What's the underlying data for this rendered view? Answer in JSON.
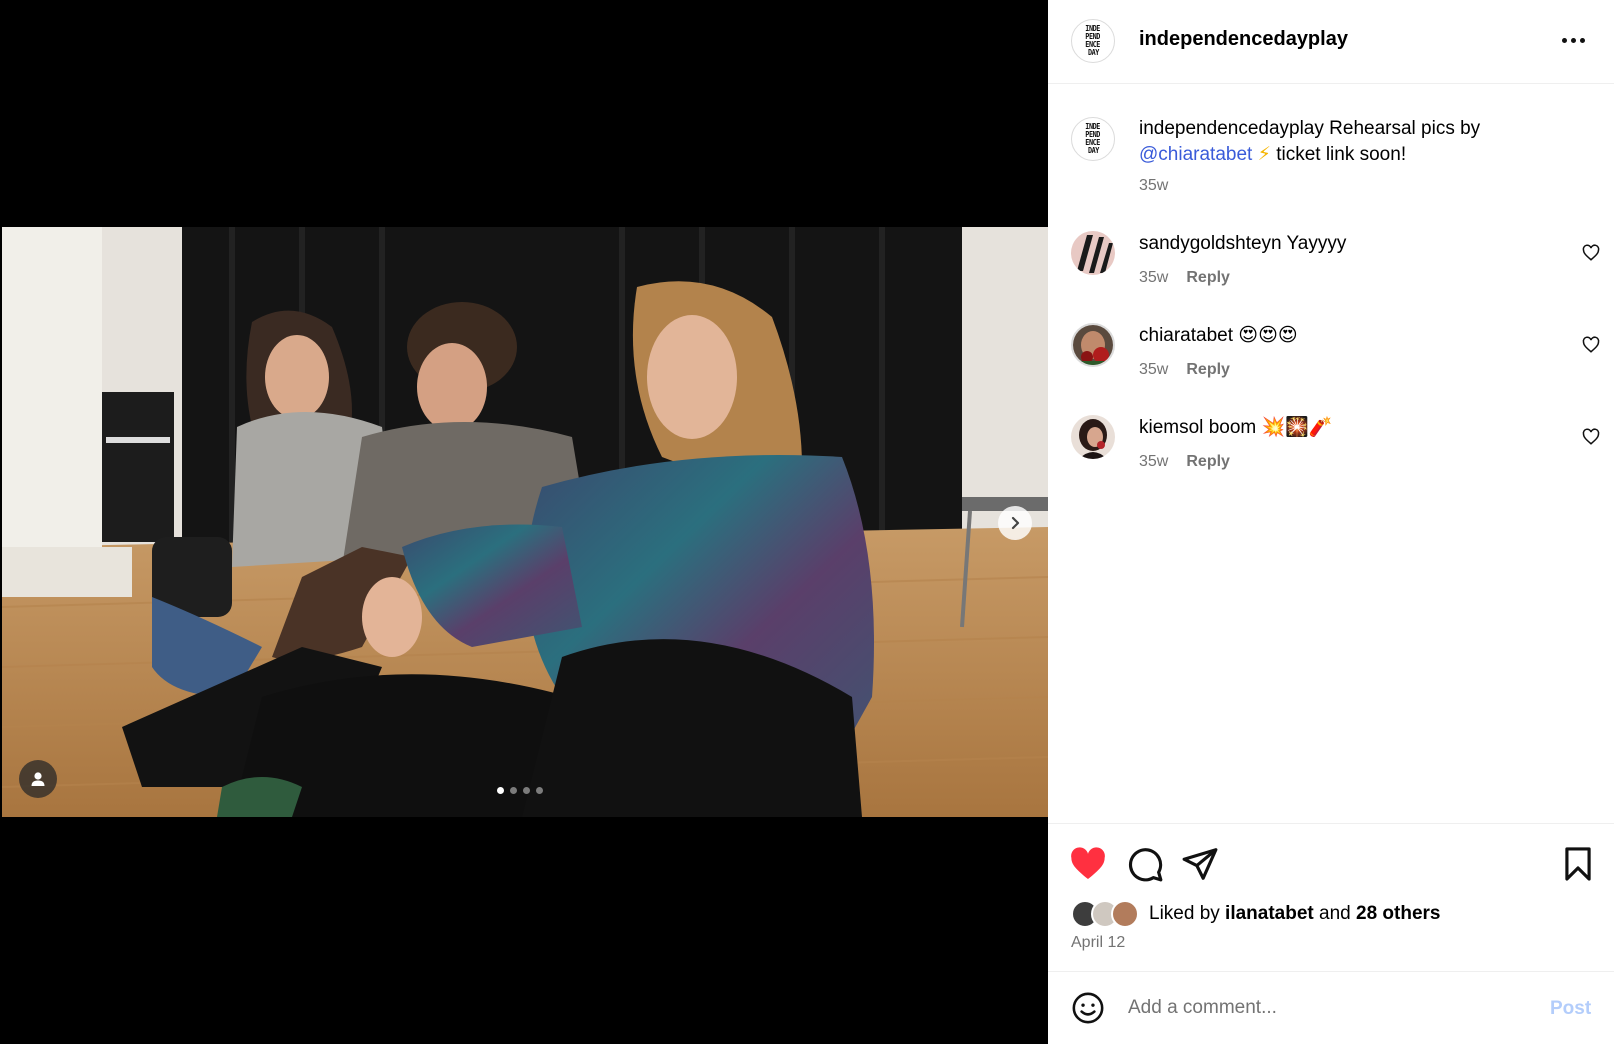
{
  "post": {
    "username": "independencedayplay",
    "avatar_lines": [
      "INDE",
      "PEND",
      "ENCE",
      "DAY"
    ],
    "caption": {
      "username": "independencedayplay",
      "text_before": " Rehearsal pics by ",
      "mention": "@chiaratabet",
      "emoji": "⚡",
      "text_after": " ticket link soon!",
      "time": "35w"
    },
    "media": {
      "description_icon": "photo-of-three-people-sitting-on-wooden-floor",
      "carousel_count": 4,
      "carousel_active": 0
    }
  },
  "comments": [
    {
      "username": "sandygoldshteyn",
      "text": "Yayyyy",
      "time": "35w",
      "reply_label": "Reply"
    },
    {
      "username": "chiaratabet",
      "text": "😍😍😍",
      "time": "35w",
      "reply_label": "Reply"
    },
    {
      "username": "kiemsol",
      "text": "boom 💥🎇🧨",
      "time": "35w",
      "reply_label": "Reply"
    }
  ],
  "likes": {
    "prefix": "Liked by ",
    "user": "ilanatabet",
    "middle": " and ",
    "others": "28 others",
    "date": "April 12"
  },
  "composer": {
    "placeholder": "Add a comment...",
    "post_label": "Post"
  },
  "colors": {
    "like_red": "#ff3040",
    "mention_blue": "#3a5bd9",
    "post_disabled_blue": "#b3cdfb",
    "meta_gray": "#737373"
  }
}
